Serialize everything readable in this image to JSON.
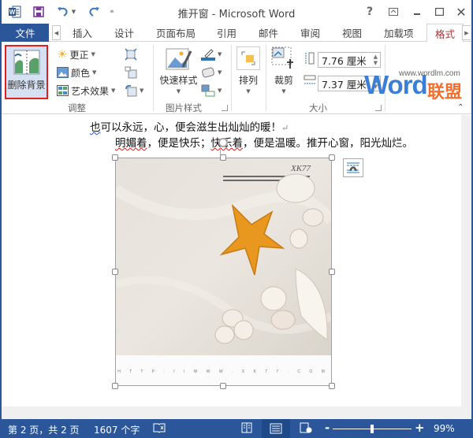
{
  "window": {
    "title": "推开窗 - Microsoft Word",
    "controls": [
      "help",
      "ribbon-display-options",
      "minimize",
      "maximize",
      "close"
    ]
  },
  "quick_access": {
    "icons": [
      "word-logo-icon",
      "save-icon",
      "undo-icon",
      "redo-icon",
      "customize-icon"
    ]
  },
  "tabs": {
    "file": "文件",
    "items": [
      "插入",
      "设计",
      "页面布局",
      "引用",
      "邮件",
      "审阅",
      "视图",
      "加载项"
    ],
    "active": "格式"
  },
  "ribbon": {
    "adjust": {
      "label": "调整",
      "remove_background": "删除背景",
      "corrections": "更正",
      "color": "颜色",
      "artistic_effects": "艺术效果"
    },
    "picture_styles": {
      "label": "图片样式",
      "quick_styles": "快速样式"
    },
    "arrange": {
      "label": "排列"
    },
    "size": {
      "label": "大小",
      "crop": "裁剪",
      "height_value": "7.76 厘米",
      "width_value": "7.37 厘米"
    },
    "watermark": {
      "url": "www.wordlm.com",
      "brand_word": "Word",
      "brand_cn": "联盟"
    }
  },
  "document": {
    "line1": {
      "squiggle_part": "也",
      "rest": "可以永远，心，便会滋生出灿灿的暖！",
      "mark": "↵"
    },
    "line2": {
      "squiggle_part1": "明媚着",
      "part2": "，便是快乐；",
      "squiggle_part3": "快乐着",
      "part4": "，便是温暖。推开心窗，阳光灿烂。"
    },
    "image": {
      "title_text": "XK77",
      "caption": "H T T P : / / W W W . X K 7 7 . C O M"
    }
  },
  "status_bar": {
    "page_info": "第 2 页，共 2 页",
    "word_count": "1607 个字",
    "zoom_minus": "-",
    "zoom_plus": "+",
    "zoom_level": "99%",
    "zoom_fraction": 0.5
  },
  "colors": {
    "accent": "#2b579a",
    "active_tab": "#a4373a",
    "highlight_border": "#e02020",
    "brand_blue": "#3a7fd5",
    "brand_orange": "#f07030"
  }
}
